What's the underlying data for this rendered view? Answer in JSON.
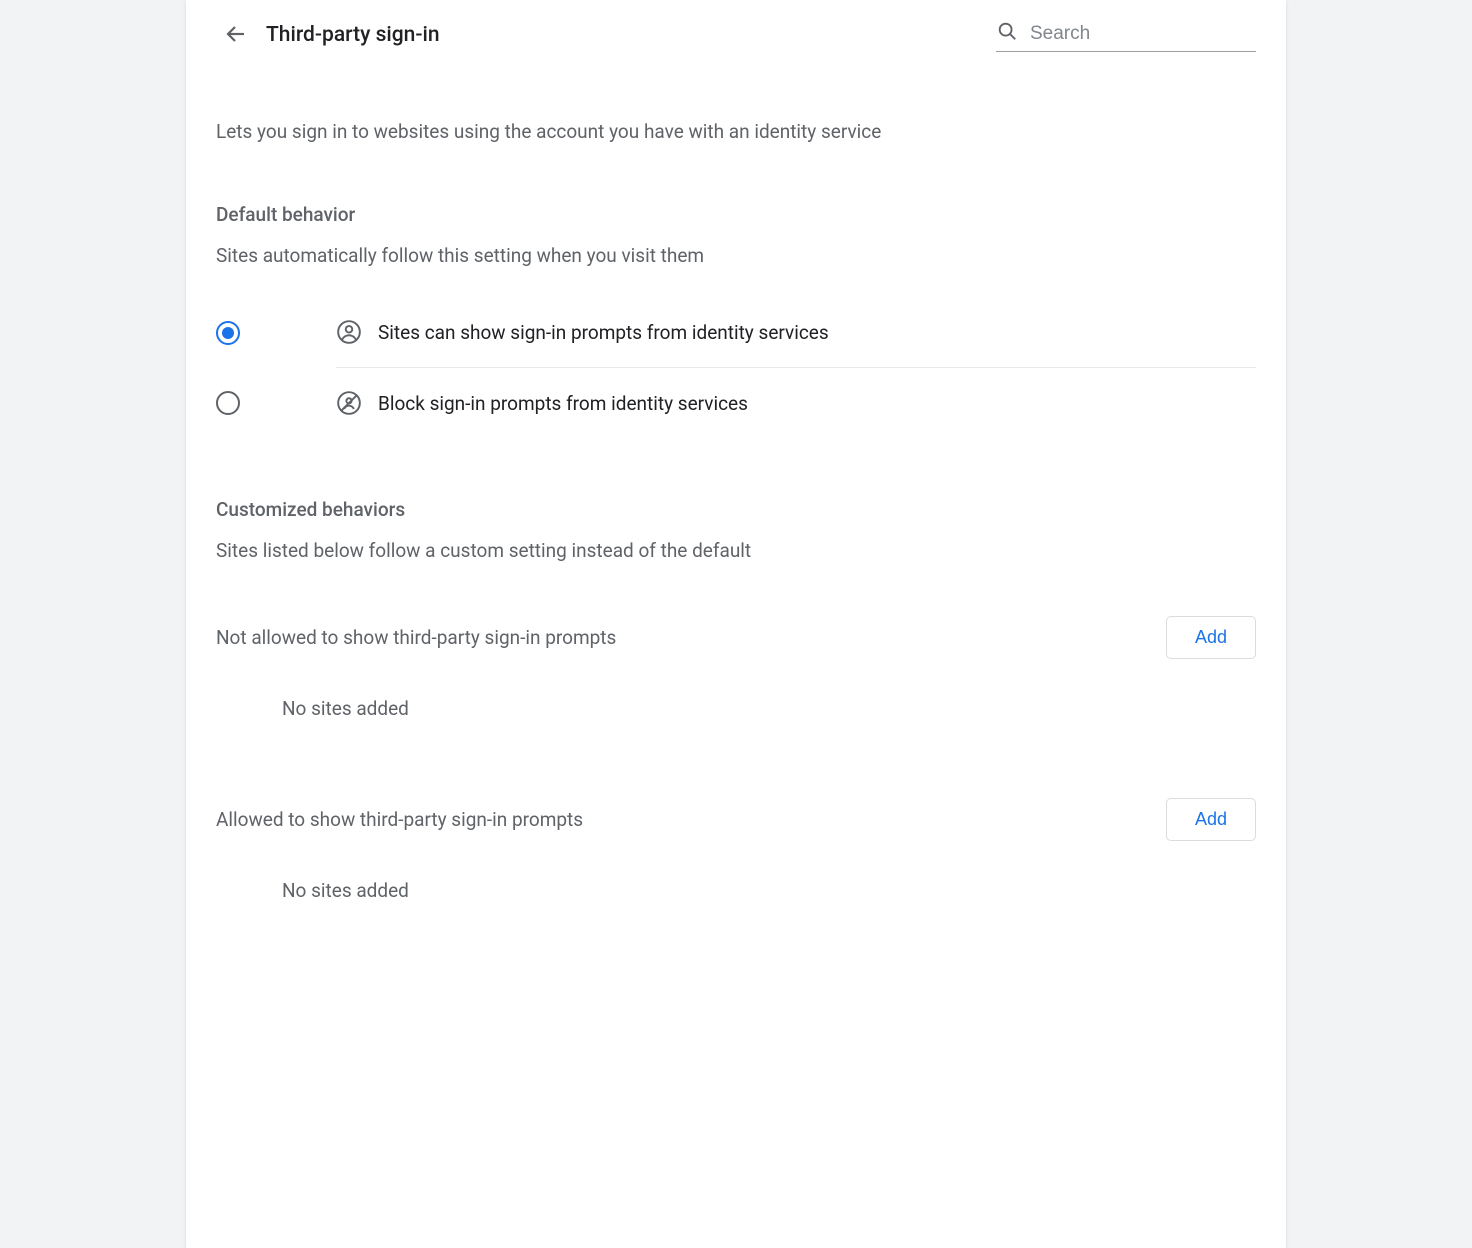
{
  "header": {
    "title": "Third-party sign-in",
    "search_placeholder": "Search"
  },
  "description": "Lets you sign in to websites using the account you have with an identity service",
  "default_behavior": {
    "heading": "Default behavior",
    "subtext": "Sites automatically follow this setting when you visit them",
    "options": [
      {
        "label": "Sites can show sign-in prompts from identity services",
        "selected": true
      },
      {
        "label": "Block sign-in prompts from identity services",
        "selected": false
      }
    ]
  },
  "customized": {
    "heading": "Customized behaviors",
    "subtext": "Sites listed below follow a custom setting instead of the default",
    "lists": [
      {
        "label": "Not allowed to show third-party sign-in prompts",
        "add_label": "Add",
        "empty_text": "No sites added"
      },
      {
        "label": "Allowed to show third-party sign-in prompts",
        "add_label": "Add",
        "empty_text": "No sites added"
      }
    ]
  }
}
